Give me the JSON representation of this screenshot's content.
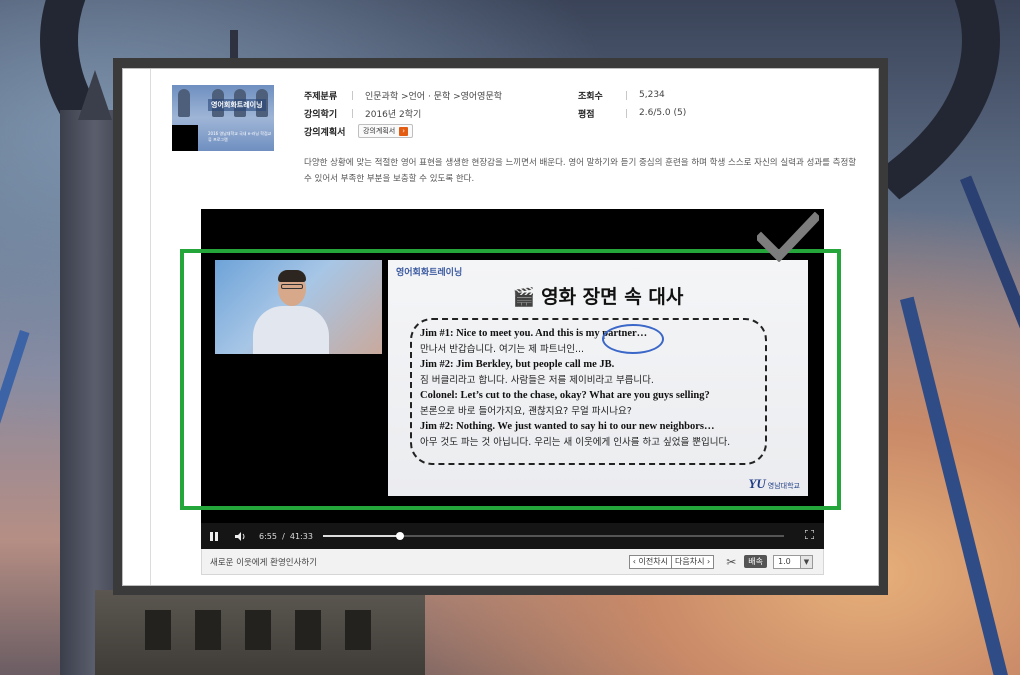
{
  "course": {
    "thumbnail_title": "영어회화트레이닝",
    "thumbnail_subtitle": "2016 영남대학교 국내 e-러닝 학점교류 프로그램"
  },
  "meta": {
    "category_label": "주제분류",
    "category_value": "인문과학 >언어 · 문학 >영어영문학",
    "term_label": "강의학기",
    "term_value": "2016년 2학기",
    "plan_label": "강의계획서",
    "plan_button": "강의계획서",
    "views_label": "조회수",
    "views_value": "5,234",
    "rating_label": "평점",
    "rating_value": "2.6/5.0 (5)"
  },
  "description": "다양한 상황에 맞는 적절한 영어 표현을 생생한 현장감을 느끼면서 배운다. 영어 말하기와 듣기 중심의 훈련을 하며 학생 스스로 자신의 실력과 성과를 측정할 수 있어서 부족한 부분을 보충할 수 있도록 한다.",
  "slide": {
    "course": "영어회화트레이닝",
    "title": "영화 장면 속 대사",
    "lines": [
      {
        "en": "Jim #1: Nice to meet you. And this is my partner…"
      },
      {
        "ko": "만나서 반갑습니다. 여기는 제 파트너인..."
      },
      {
        "en": "Jim #2: Jim Berkley, but people call me JB."
      },
      {
        "ko": "짐 버클리라고 합니다. 사람들은 저를 제이비라고 부릅니다."
      },
      {
        "en": "Colonel: Let’s cut to the chase, okay? What are you guys selling?"
      },
      {
        "ko": "본론으로 바로 들어가지요, 괜찮지요? 무얼 파시나요?"
      },
      {
        "en": "Jim #2: Nothing. We just wanted to say hi to our new neighbors…"
      },
      {
        "ko": "아무 것도 파는 것 아닙니다. 우리는 새 이웃에게 인사를 하고 싶었을 뿐입니다."
      }
    ],
    "logo_mark": "YU",
    "logo_text": "영남대학교"
  },
  "player": {
    "current_time": "6:55",
    "separator": "/",
    "total_time": "41:33",
    "progress": 0.166,
    "play_state_icon": "pause-icon",
    "chapter_title": "새로운 이웃에게 환영인사하기",
    "prev_button": "이전차시",
    "next_button": "다음차시",
    "speed_label": "배속",
    "speed_value": "1.0"
  },
  "colors": {
    "highlight": "#25a63b",
    "accent_orange": "#e35c12",
    "annotation_blue": "#3a67c8"
  }
}
